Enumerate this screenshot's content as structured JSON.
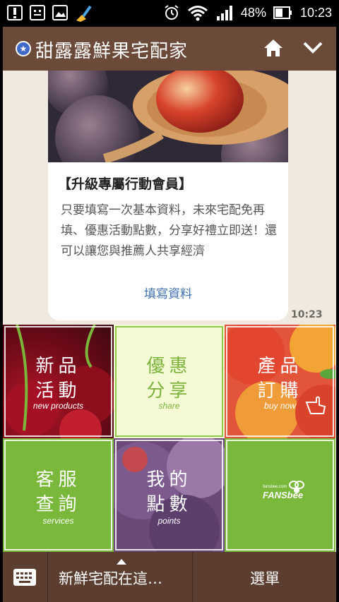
{
  "statusbar": {
    "battery": "48%",
    "time": "10:23"
  },
  "appbar": {
    "title": "甜露露鮮果宅配家"
  },
  "message": {
    "title": "【升級專屬行動會員】",
    "body": "只要填寫一次基本資料，未來宅配免再填、優惠活動點數，分享好禮立即送！還可以讓您與推薦人共享經濟",
    "link": "填寫資料",
    "time": "10:23"
  },
  "tiles": [
    {
      "line1": "新品",
      "line2": "活動",
      "sub": "new products"
    },
    {
      "line1": "優惠",
      "line2": "分享",
      "sub": "share"
    },
    {
      "line1": "產品",
      "line2": "訂購",
      "sub": "buy now"
    },
    {
      "line1": "客服",
      "line2": "查詢",
      "sub": "services"
    },
    {
      "line1": "我的",
      "line2": "點數",
      "sub": "points"
    },
    {
      "logo_small": "fansbee.com",
      "logo_main": "FANSbee"
    }
  ],
  "bottombar": {
    "left_label": "新鮮宅配在這…",
    "right_label": "選單"
  }
}
